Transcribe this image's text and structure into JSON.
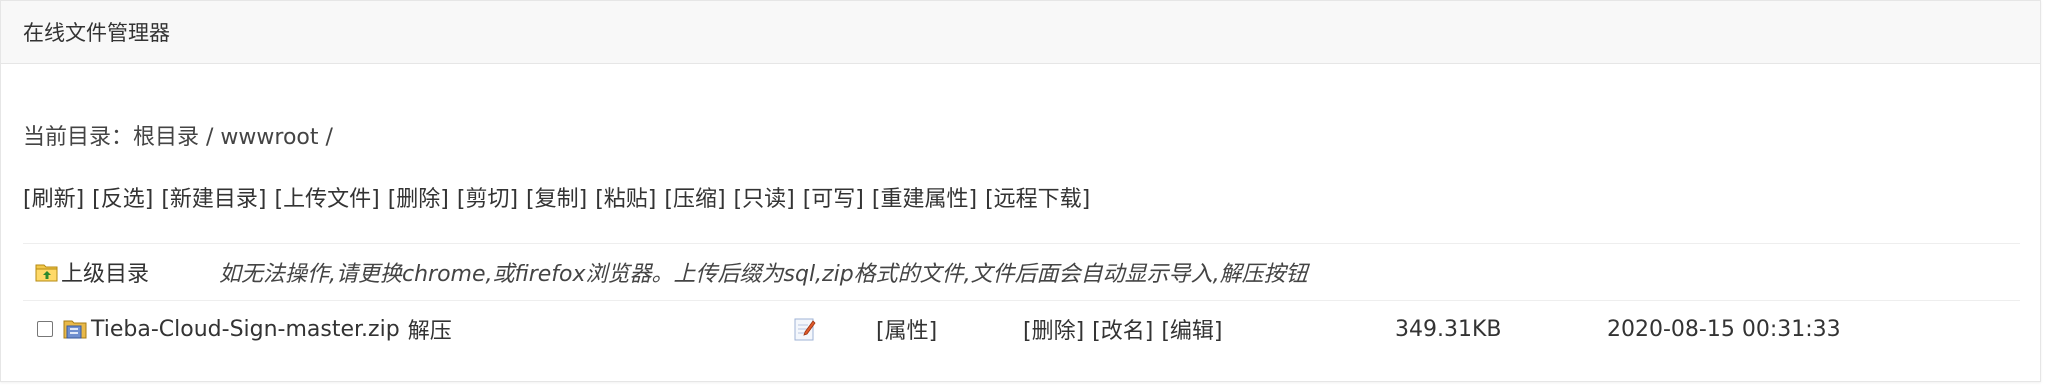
{
  "header": {
    "title": "在线文件管理器"
  },
  "path": {
    "text": "当前目录：根目录 / wwwroot /"
  },
  "toolbar": {
    "items": [
      "[刷新]",
      "[反选]",
      "[新建目录]",
      "[上传文件]",
      "[删除]",
      "[剪切]",
      "[复制]",
      "[粘贴]",
      "[压缩]",
      "[只读]",
      "[可写]",
      "[重建属性]",
      "[远程下载]"
    ]
  },
  "parent_row": {
    "label": "上级目录",
    "note": "如无法操作,请更换chrome,或firefox浏览器。上传后缀为sql,zip格式的文件,文件后面会自动显示导入,解压按钮"
  },
  "files": [
    {
      "name": "Tieba-Cloud-Sign-master.zip",
      "extract": "解压",
      "props": "[属性]",
      "delete": "[删除]",
      "rename": "[改名]",
      "edit": "[编辑]",
      "size": "349.31KB",
      "modified": "2020-08-15 00:31:33"
    }
  ],
  "icons": {
    "parent": "folder-up-icon",
    "file": "zip-file-icon",
    "edit": "edit-pencil-icon"
  },
  "colors": {
    "header_bg": "#f8f8f8",
    "border": "#e6e6e6",
    "text": "#333333"
  }
}
